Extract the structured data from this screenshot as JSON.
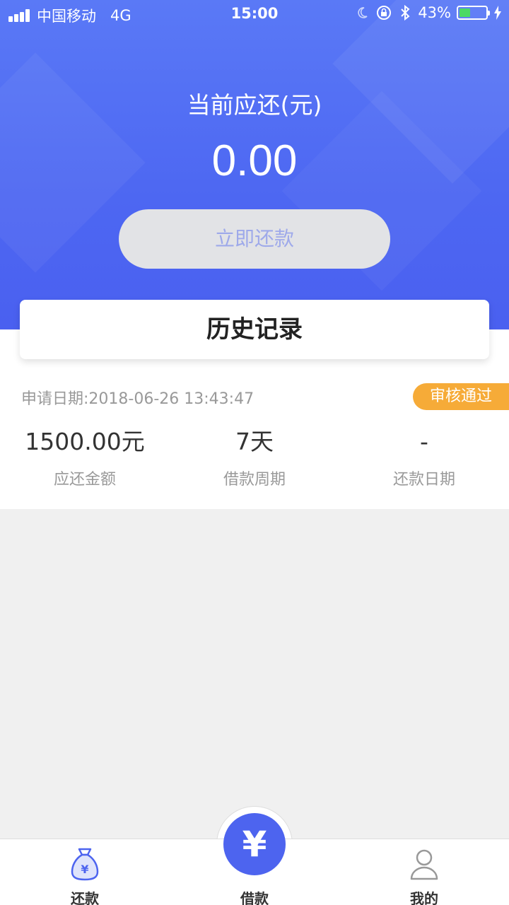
{
  "status_bar": {
    "carrier": "中国移动",
    "network": "4G",
    "time": "15:00",
    "battery": "43%",
    "battery_level": 0.43,
    "icons": [
      "moon-icon",
      "rotation-lock-icon",
      "bluetooth-icon",
      "charging-icon"
    ]
  },
  "hero": {
    "title": "当前应还(元)",
    "amount": "0.00",
    "repay_button": "立即还款"
  },
  "history": {
    "title": "历史记录"
  },
  "record": {
    "date": "申请日期:2018-06-26 13:43:47",
    "status": "审核通过",
    "stats": [
      {
        "value": "1500.00元",
        "label": "应还金额"
      },
      {
        "value": "7天",
        "label": "借款周期"
      },
      {
        "value": "-",
        "label": "还款日期"
      }
    ]
  },
  "tab_bar": {
    "tabs": [
      {
        "label": "还款",
        "icon": "money-bag-icon"
      },
      {
        "label": "借款",
        "icon": "yuan-icon"
      },
      {
        "label": "我的",
        "icon": "user-icon"
      }
    ],
    "center_symbol": "¥"
  },
  "colors": {
    "primary": "#4d64ef",
    "badge": "#f6ab38",
    "background": "#f0f0f0"
  }
}
